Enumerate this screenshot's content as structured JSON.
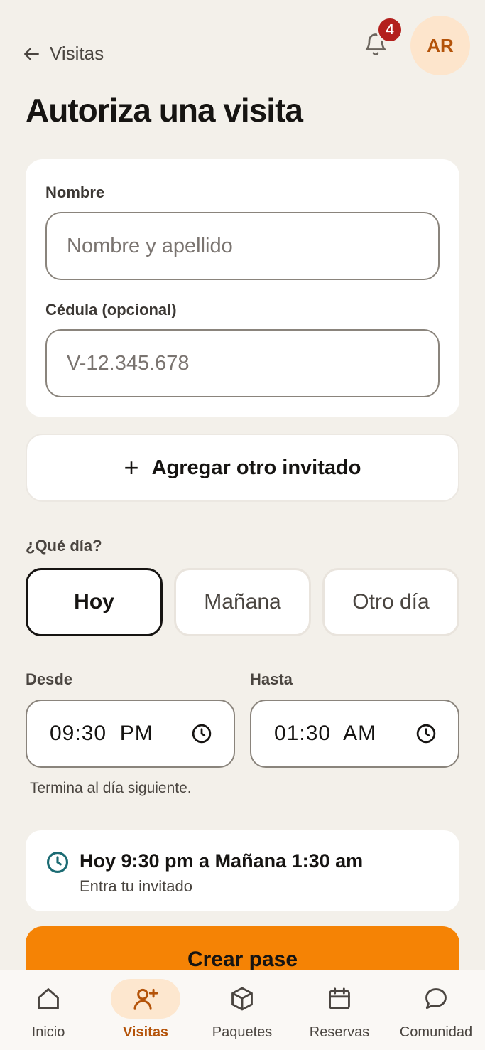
{
  "header": {
    "back_label": "Visitas",
    "notification_count": "4",
    "avatar_initials": "AR",
    "title": "Autoriza una visita"
  },
  "form": {
    "name_label": "Nombre",
    "name_placeholder": "Nombre y apellido",
    "id_label": "Cédula (opcional)",
    "id_placeholder": "V-12.345.678",
    "add_guest_label": "Agregar otro invitado"
  },
  "day": {
    "label": "¿Qué día?",
    "options": [
      "Hoy",
      "Mañana",
      "Otro día"
    ],
    "selected": "Hoy"
  },
  "time": {
    "from_label": "Desde",
    "from_value": "09:30  PM",
    "to_label": "Hasta",
    "to_value": "01:30  AM",
    "hint": "Termina al día siguiente."
  },
  "summary": {
    "title": "Hoy 9:30 pm a Mañana 1:30 am",
    "subtitle": "Entra tu invitado"
  },
  "create_button_label": "Crear pase",
  "nav": {
    "items": [
      {
        "label": "Inicio",
        "icon": "home-icon"
      },
      {
        "label": "Visitas",
        "icon": "user-plus-icon",
        "active": true
      },
      {
        "label": "Paquetes",
        "icon": "package-icon"
      },
      {
        "label": "Reservas",
        "icon": "calendar-icon"
      },
      {
        "label": "Comunidad",
        "icon": "chat-icon"
      }
    ]
  },
  "colors": {
    "accent": "#f58305",
    "accent_text": "#b45309",
    "badge": "#b3201d",
    "background": "#f3f0ea",
    "teal_icon": "#1b6b73"
  }
}
